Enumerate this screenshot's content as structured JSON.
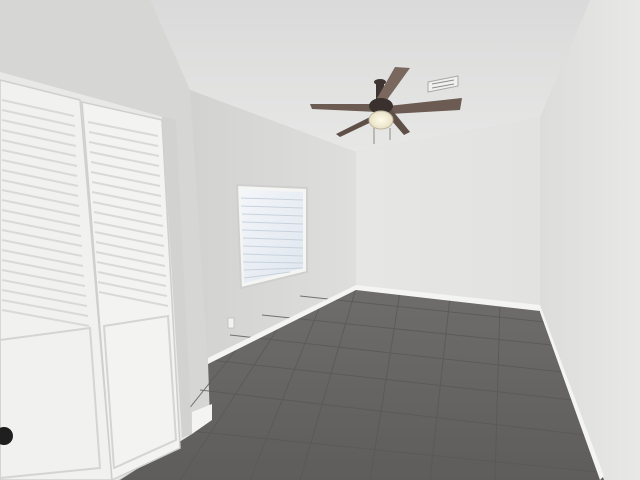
{
  "scene": {
    "subject": "empty-bedroom",
    "colors": {
      "ceiling": "#e2e2e0",
      "back_wall": "#e6e6e4",
      "left_wall": "#dcdcda",
      "right_wall": "#e0e0de",
      "floor": "#6a6866",
      "door_white": "#f1f1ef",
      "fan_blade": "#6b5b52",
      "window_blind": "#e9eef4"
    },
    "objects": [
      "bifold-closet-door",
      "ceiling-fan",
      "window-with-blinds",
      "tile-floor",
      "baseboard",
      "air-vent",
      "wall-outlet"
    ]
  },
  "watermark": {
    "text": ""
  }
}
